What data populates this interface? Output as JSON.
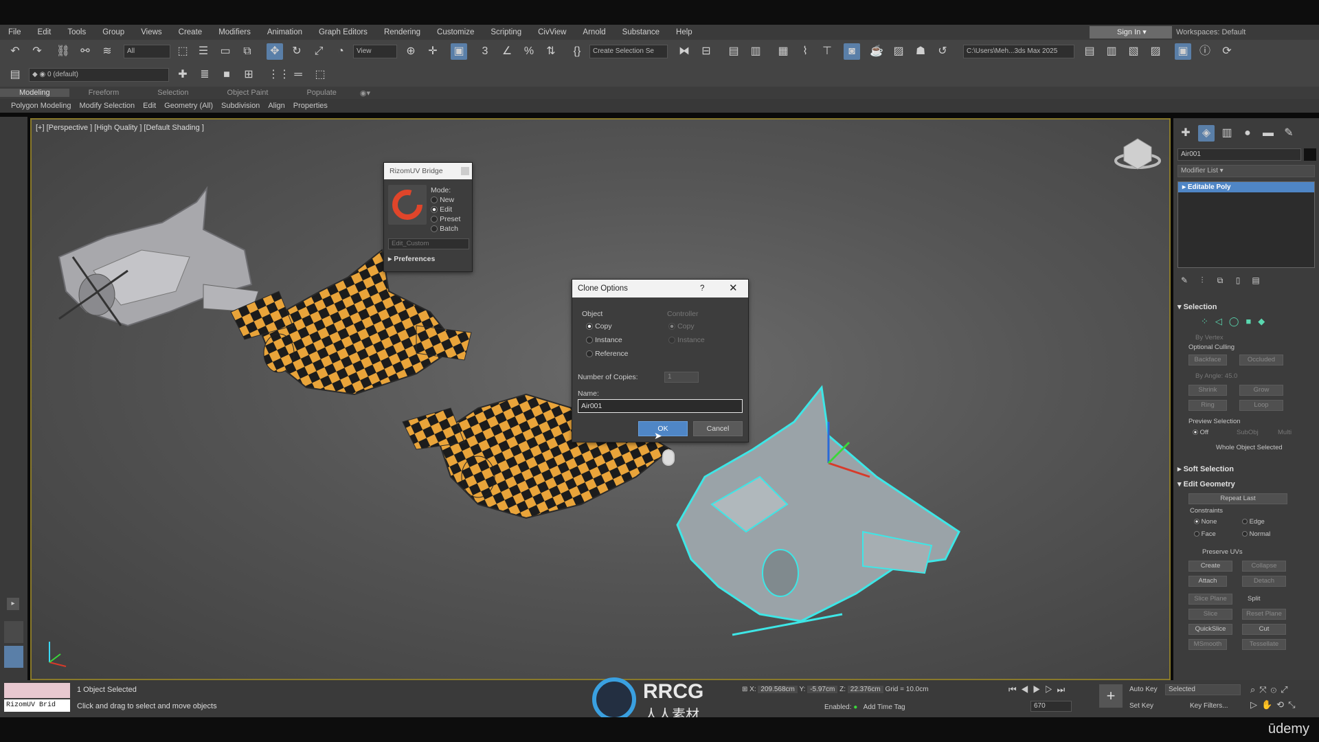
{
  "menu": {
    "items": [
      "File",
      "Edit",
      "Tools",
      "Group",
      "Views",
      "Create",
      "Modifiers",
      "Animation",
      "Graph Editors",
      "Rendering",
      "Customize",
      "Scripting",
      "CivView",
      "Arnold",
      "Substance",
      "Help"
    ]
  },
  "account": {
    "signin_label": "Sign In",
    "workspace_label": "Workspaces:",
    "workspace_value": "Default"
  },
  "toolbar": {
    "selection_filter": "All",
    "ref_coord": "View",
    "selection_set": "Create Selection Se",
    "project_path": "C:\\Users\\Meh...3ds Max 2025",
    "layer_value": "0 (default)"
  },
  "ribbon": {
    "tabs": [
      "Modeling",
      "Freeform",
      "Selection",
      "Object Paint",
      "Populate"
    ],
    "subtabs": [
      "Polygon Modeling",
      "Modify Selection",
      "Edit",
      "Geometry (All)",
      "Subdivision",
      "Align",
      "Properties"
    ]
  },
  "viewport": {
    "label": "[+] [Perspective ] [High Quality ] [Default Shading ]"
  },
  "rizom": {
    "title": "RizomUV Bridge",
    "mode_label": "Mode:",
    "modes": [
      "New",
      "Edit",
      "Preset",
      "Batch"
    ],
    "selected_mode": "Edit",
    "preset_value": "Edit_Custom",
    "preferences_label": "Preferences"
  },
  "clone": {
    "title": "Clone Options",
    "help": "?",
    "object_group": "Object",
    "object_options": [
      "Copy",
      "Instance",
      "Reference"
    ],
    "controller_group": "Controller",
    "controller_options": [
      "Copy",
      "Instance"
    ],
    "copies_label": "Number of Copies:",
    "copies_value": "1",
    "name_label": "Name:",
    "name_value": "Air001",
    "ok_label": "OK",
    "cancel_label": "Cancel"
  },
  "cmdpanel": {
    "object_name": "Air001",
    "modifier_list": "Modifier List",
    "stack_item": "Editable Poly",
    "selection_title": "Selection",
    "by_vertex": "By Vertex",
    "ignore_backfacing": "Optional Culling",
    "backface": "Backface",
    "occluded": "Occluded",
    "by_angle": "By Angle:",
    "by_angle_value": "45.0",
    "shrink": "Shrink",
    "grow": "Grow",
    "ring": "Ring",
    "loop": "Loop",
    "preview_selection": "Preview Selection",
    "preview_off": "Off",
    "preview_subobj": "SubObj",
    "preview_multi": "Multi",
    "whole_object": "Whole Object Selected",
    "soft_selection": "Soft Selection",
    "edit_geometry": "Edit Geometry",
    "repeat_last": "Repeat Last",
    "constraints": "Constraints",
    "c_none": "None",
    "c_edge": "Edge",
    "c_face": "Face",
    "c_normal": "Normal",
    "preserve_uvs": "Preserve UVs",
    "create": "Create",
    "collapse": "Collapse",
    "attach": "Attach",
    "detach": "Detach",
    "slice_plane": "Slice Plane",
    "split": "Split",
    "slice": "Slice",
    "reset_plane": "Reset Plane",
    "quickslice": "QuickSlice",
    "cut": "Cut",
    "msmooth": "MSmooth",
    "tessellate": "Tessellate"
  },
  "status": {
    "script_label": "RizomUV Brid",
    "selected": "1 Object Selected",
    "prompt": "Click and drag to select and move objects",
    "x_label": "X:",
    "x_value": "209.568cm",
    "y_label": "Y:",
    "y_value": "-5.97cm",
    "z_label": "Z:",
    "z_value": "22.376cm",
    "grid": "Grid = 10.0cm",
    "enabled_label": "Enabled:",
    "add_time_tag": "Add Time Tag",
    "auto_key": "Auto Key",
    "selected_dropdown": "Selected",
    "set_key": "Set Key",
    "key_filters": "Key Filters...",
    "frame_value": "670"
  },
  "watermark": {
    "brand": "RRCG",
    "sub": "人人素材"
  },
  "platform": {
    "label": "ūdemy"
  },
  "colors": {
    "accent": "#4f86c6",
    "selection_outline": "#3ee6e6",
    "checker_orange": "#e9a43a"
  }
}
